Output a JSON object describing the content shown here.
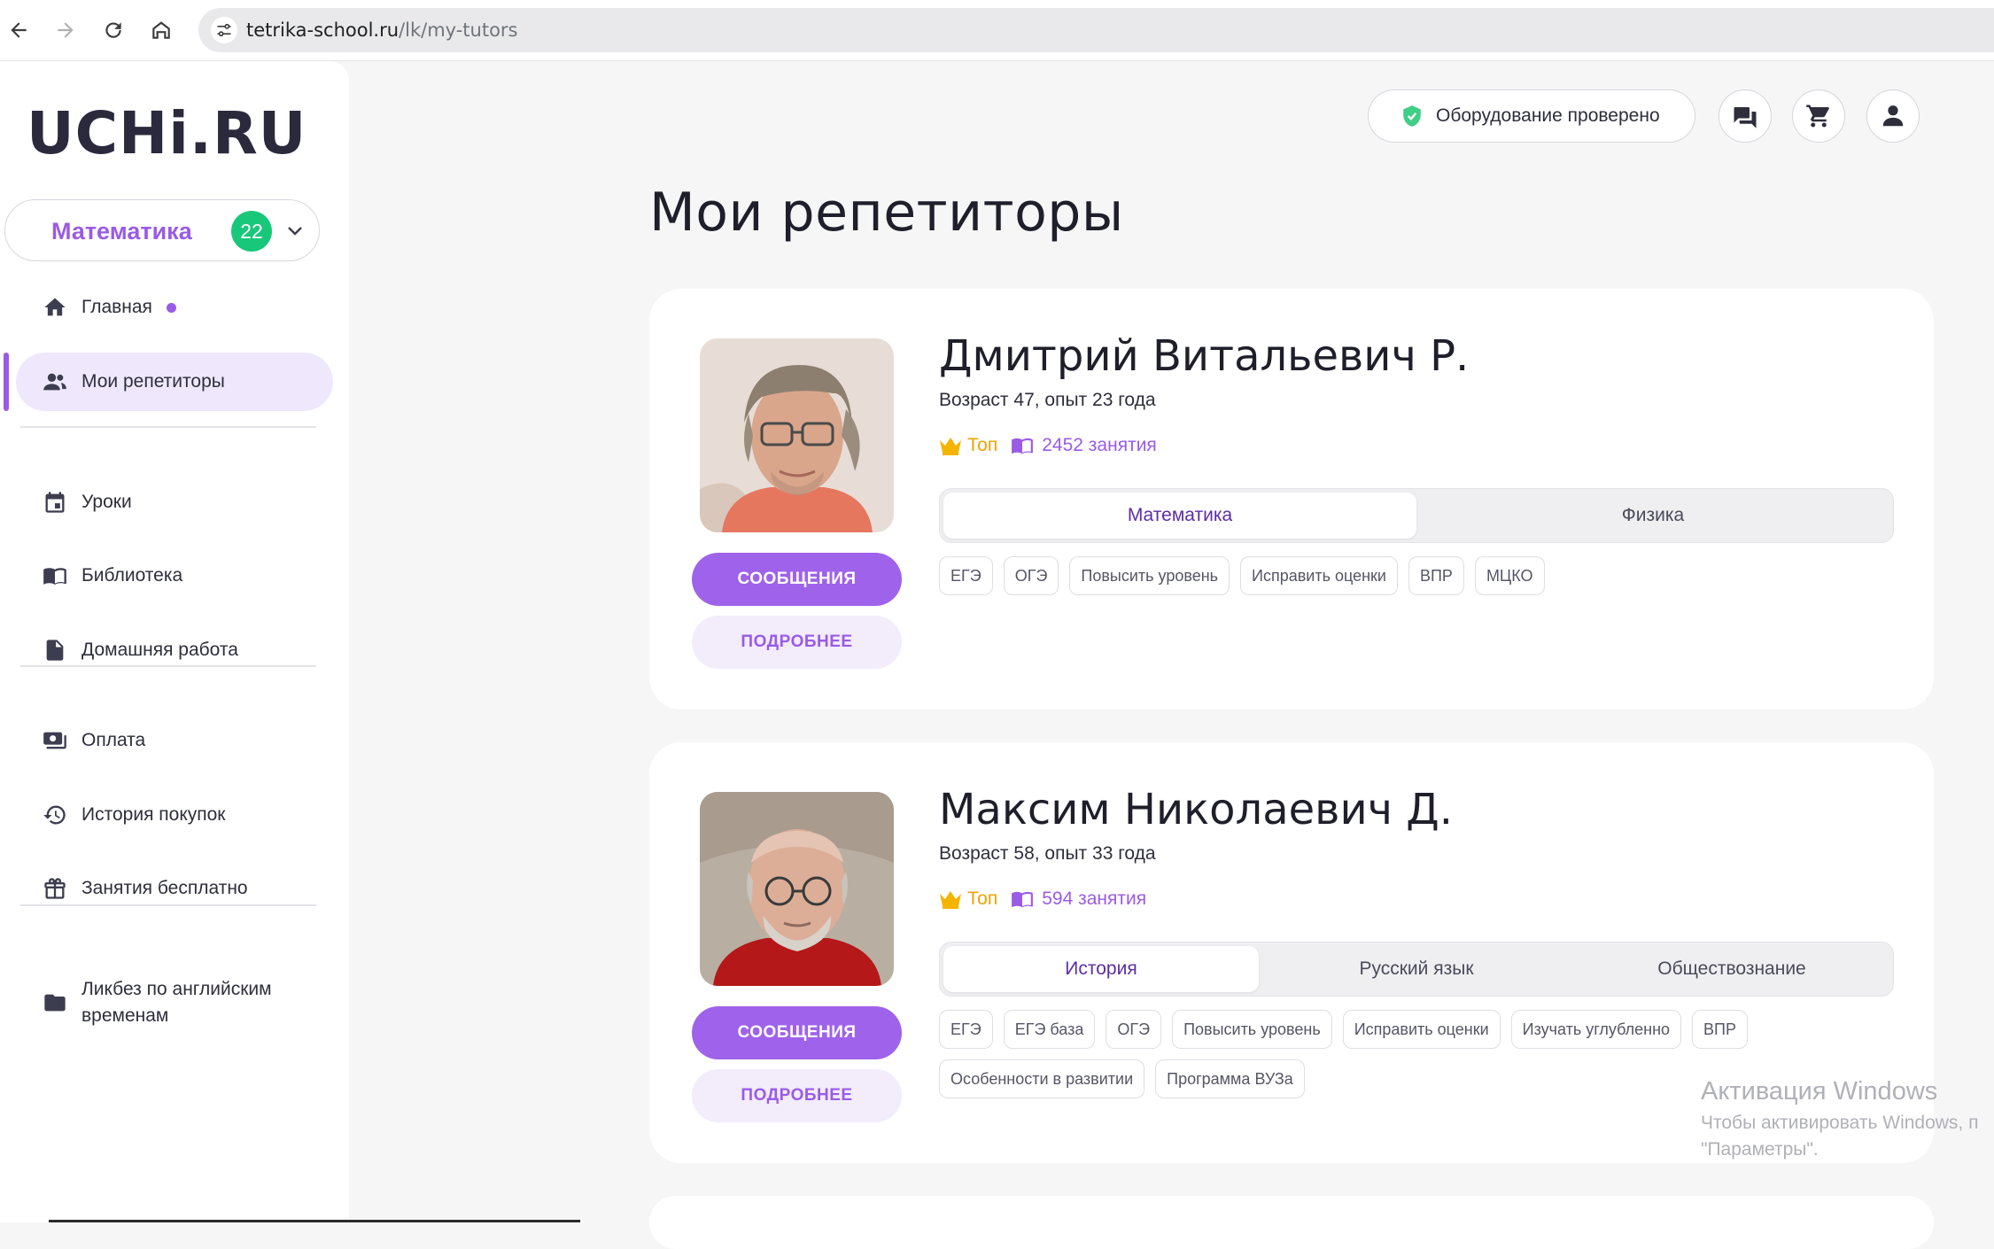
{
  "browser": {
    "url_host": "tetrika-school.ru",
    "url_path": "/lk/my-tutors"
  },
  "sidebar": {
    "logo": "UCHi.RU",
    "subject": {
      "label": "Математика",
      "badge": "22"
    },
    "items": [
      {
        "label": "Главная"
      },
      {
        "label": "Мои репетиторы"
      },
      {
        "label": "Уроки"
      },
      {
        "label": "Библиотека"
      },
      {
        "label": "Домашняя работа"
      },
      {
        "label": "Оплата"
      },
      {
        "label": "История покупок"
      },
      {
        "label": "Занятия бесплатно"
      },
      {
        "label": "Ликбез по английским временам"
      }
    ]
  },
  "header": {
    "equipment_label": "Оборудование проверено"
  },
  "page_title": "Мои репетиторы",
  "tutors": [
    {
      "name": "Дмитрий Витальевич Р.",
      "info": "Возраст 47, опыт 23 года",
      "top_label": "Топ",
      "lessons": "2452 занятия",
      "subjects": [
        "Математика",
        "Физика"
      ],
      "tags": [
        "ЕГЭ",
        "ОГЭ",
        "Повысить уровень",
        "Исправить оценки",
        "ВПР",
        "МЦКО"
      ],
      "messages_label": "СООБЩЕНИЯ",
      "more_label": "ПОДРОБНЕЕ"
    },
    {
      "name": "Максим Николаевич Д.",
      "info": "Возраст 58, опыт 33 года",
      "top_label": "Топ",
      "lessons": "594 занятия",
      "subjects": [
        "История",
        "Русский язык",
        "Обществознание"
      ],
      "tags": [
        "ЕГЭ",
        "ЕГЭ база",
        "ОГЭ",
        "Повысить уровень",
        "Исправить оценки",
        "Изучать углубленно",
        "ВПР",
        "Особенности в развитии",
        "Программа ВУЗа"
      ],
      "messages_label": "СООБЩЕНИЯ",
      "more_label": "ПОДРОБНЕЕ"
    }
  ],
  "watermark": {
    "title": "Активация Windows",
    "line1": "Чтобы активировать Windows, п",
    "line2": "\"Параметры\"."
  },
  "colors": {
    "accent": "#9a5be6",
    "badge_green": "#19c77a",
    "top_gold": "#f0a300"
  }
}
